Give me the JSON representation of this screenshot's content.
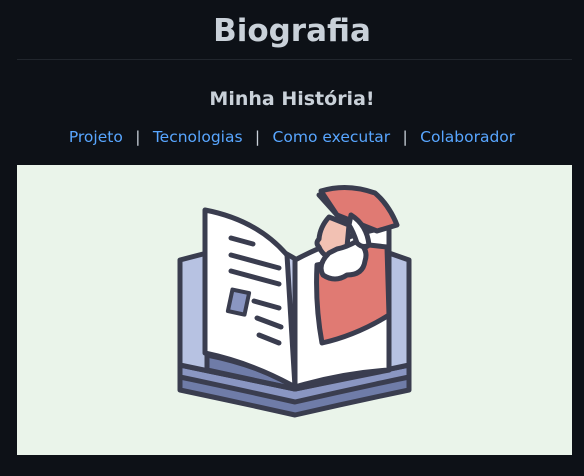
{
  "header": {
    "title": "Biografia",
    "subtitle": "Minha História!"
  },
  "nav": {
    "links": [
      {
        "label": "Projeto"
      },
      {
        "label": "Tecnologias"
      },
      {
        "label": "Como executar"
      },
      {
        "label": "Colaborador"
      }
    ],
    "separator": "|"
  },
  "hero": {
    "icon": "book-biography-illustration",
    "background": "#eaf4ea"
  },
  "colors": {
    "page_background": "#0d1117",
    "text": "#c9d1d9",
    "link": "#58a6ff"
  }
}
